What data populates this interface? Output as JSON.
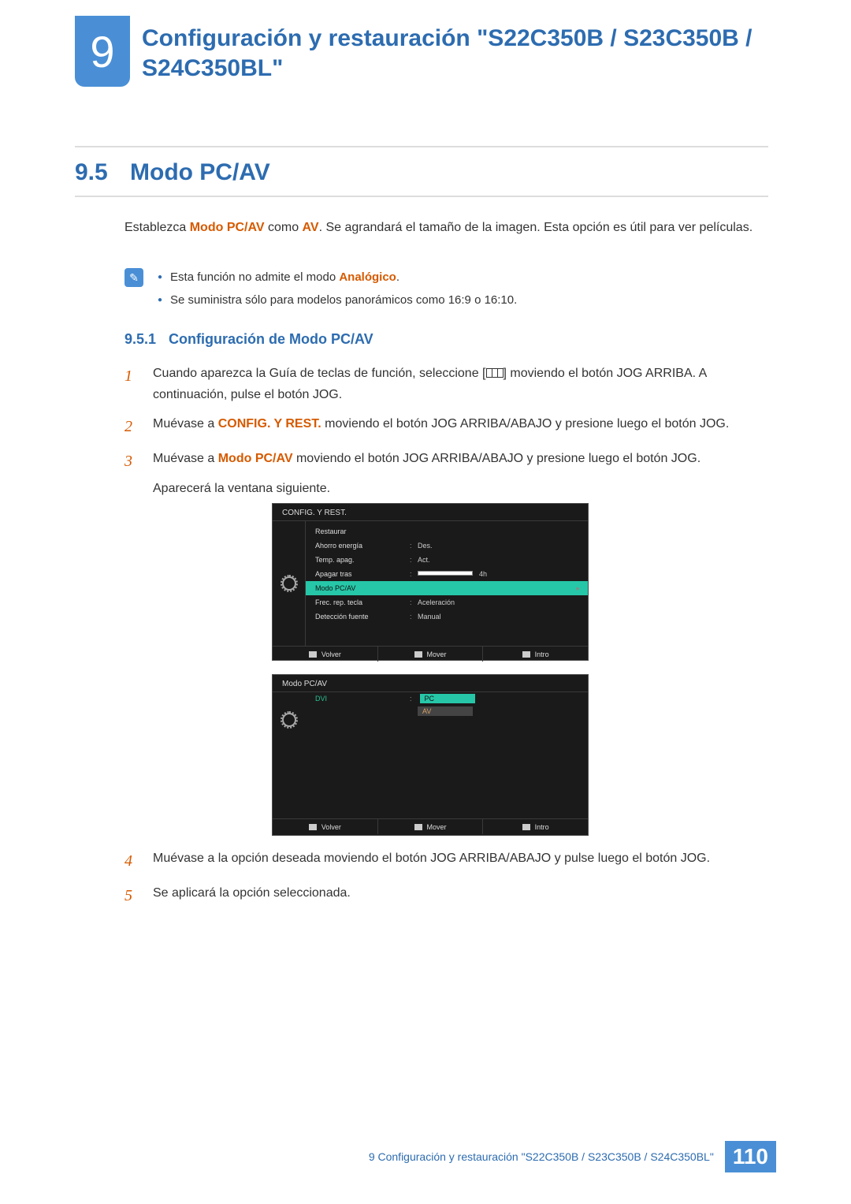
{
  "chapter": {
    "number": "9",
    "title": "Configuración y restauración \"S22C350B / S23C350B / S24C350BL\""
  },
  "section": {
    "number": "9.5",
    "title": "Modo PC/AV"
  },
  "intro": {
    "pre": "Establezca ",
    "kw1": "Modo PC/AV",
    "mid": " como ",
    "kw2": "AV",
    "post": ". Se agrandará el tamaño de la imagen. Esta opción es útil para ver películas."
  },
  "notes": [
    {
      "pre": "Esta función no admite el modo ",
      "kw": "Analógico",
      "post": "."
    },
    {
      "text": "Se suministra sólo para modelos panorámicos como 16:9 o 16:10."
    }
  ],
  "subsection": {
    "number": "9.5.1",
    "title": "Configuración de Modo PC/AV"
  },
  "steps_upper": [
    {
      "n": "1",
      "pre": "Cuando aparezca la Guía de teclas de función, seleccione [",
      "post": "] moviendo el botón JOG ARRIBA. A continuación, pulse el botón JOG."
    },
    {
      "n": "2",
      "pre": "Muévase a ",
      "kw": "CONFIG. Y REST.",
      "post": " moviendo el botón JOG ARRIBA/ABAJO y presione luego el botón JOG."
    },
    {
      "n": "3",
      "pre": "Muévase a ",
      "kw": "Modo PC/AV",
      "post": " moviendo el botón JOG ARRIBA/ABAJO y presione luego el botón JOG.",
      "extra": "Aparecerá la ventana siguiente."
    }
  ],
  "steps_lower": [
    {
      "n": "4",
      "text": "Muévase a la opción deseada moviendo el botón JOG ARRIBA/ABAJO y pulse luego el botón JOG."
    },
    {
      "n": "5",
      "text": "Se aplicará la opción seleccionada."
    }
  ],
  "osd1": {
    "title": "CONFIG. Y REST.",
    "rows": [
      {
        "label": "Restaurar",
        "val": ""
      },
      {
        "label": "Ahorro energía",
        "val": "Des."
      },
      {
        "label": "Temp. apag.",
        "val": "Act."
      },
      {
        "label": "Apagar tras",
        "val": "4h",
        "slider": true
      },
      {
        "label": "Modo PC/AV",
        "val": "",
        "hl": true,
        "arrow": true
      },
      {
        "label": "Frec. rep. tecla",
        "val": "Aceleración"
      },
      {
        "label": "Detección fuente",
        "val": "Manual"
      }
    ],
    "footer": {
      "back": "Volver",
      "move": "Mover",
      "enter": "Intro"
    }
  },
  "osd2": {
    "title": "Modo PC/AV",
    "dvi_label": "DVI",
    "opt_sel": "PC",
    "opt_unsel": "AV",
    "footer": {
      "back": "Volver",
      "move": "Mover",
      "enter": "Intro"
    }
  },
  "footer": {
    "text": "9 Configuración y restauración \"S22C350B / S23C350B / S24C350BL\"",
    "page": "110"
  }
}
